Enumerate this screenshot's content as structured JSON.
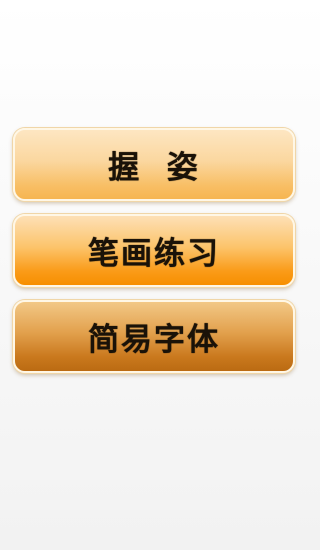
{
  "menu": {
    "items": [
      {
        "label": "握  姿"
      },
      {
        "label": "笔画练习"
      },
      {
        "label": "简易字体"
      }
    ]
  },
  "colors": {
    "background": "#f7f7f7",
    "button_light": "#fbd79f",
    "button_orange": "#fa9b18",
    "button_dark": "#c9781d",
    "text": "#1a1208"
  }
}
